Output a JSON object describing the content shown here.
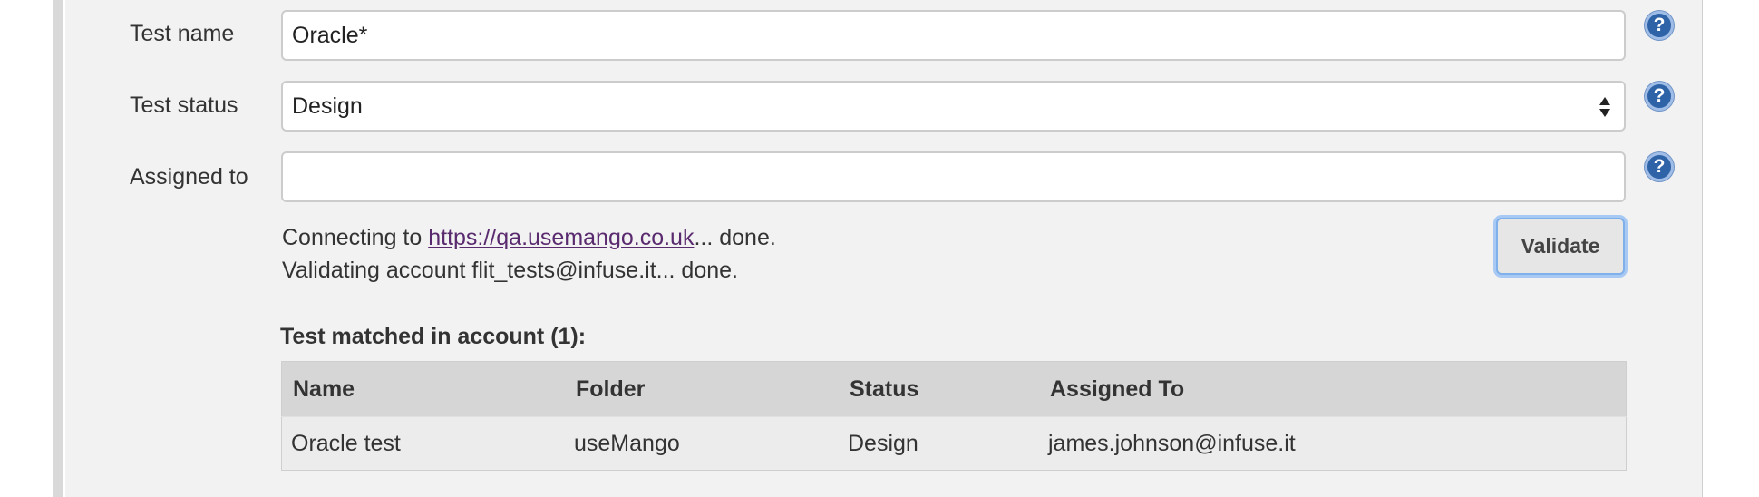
{
  "form": {
    "test_name": {
      "label": "Test name",
      "value": "Oracle*"
    },
    "test_status": {
      "label": "Test status",
      "value": "Design"
    },
    "assigned_to": {
      "label": "Assigned to",
      "value": ""
    },
    "help_glyph": "?"
  },
  "validation": {
    "connecting_prefix": "Connecting to ",
    "connecting_link": "https://qa.usemango.co.uk",
    "connecting_suffix": "... done.",
    "validating_line": "Validating account flit_tests@infuse.it... done.",
    "validate_button": "Validate"
  },
  "results": {
    "heading": "Test matched in account (1):",
    "columns": [
      "Name",
      "Folder",
      "Status",
      "Assigned To"
    ],
    "rows": [
      [
        "Oracle test",
        "useMango",
        "Design",
        "james.johnson@infuse.it"
      ]
    ]
  },
  "icons": {
    "help": "help-icon",
    "select_arrows": "sort-arrows-icon"
  },
  "colors": {
    "panel_bg": "#f2f2f2",
    "help_icon": "#2f63a8",
    "link": "#5a2a6f",
    "focus_ring": "#a7c9f3"
  }
}
